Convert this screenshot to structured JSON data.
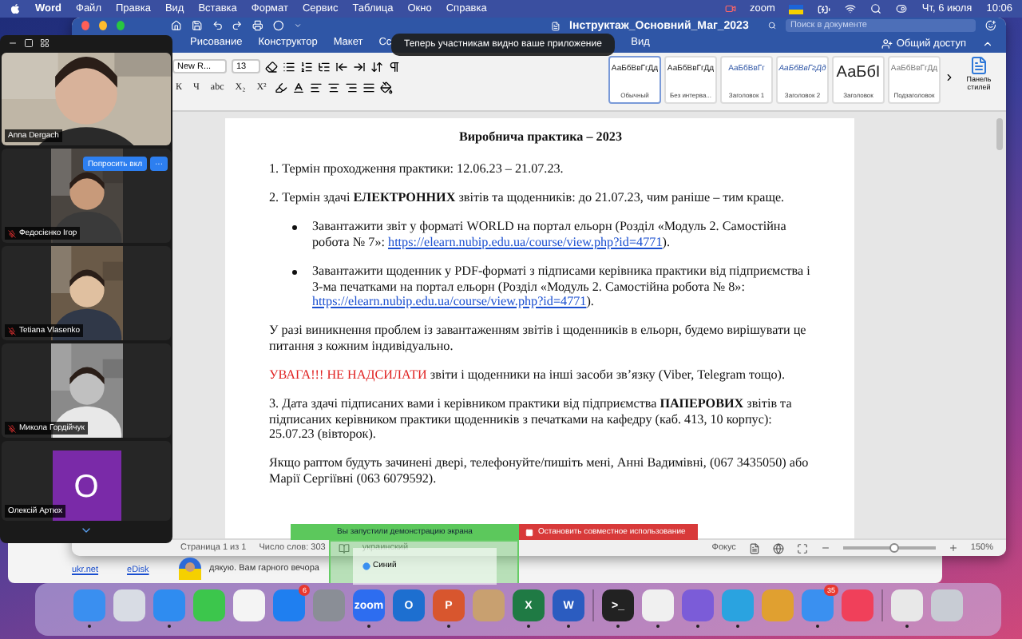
{
  "menu_bar": {
    "app": "Word",
    "items": [
      "Файл",
      "Правка",
      "Вид",
      "Вставка",
      "Формат",
      "Сервис",
      "Таблица",
      "Окно",
      "Справка"
    ],
    "zoom_label": "zoom",
    "date": "Чт, 6 июля",
    "time": "10:06"
  },
  "word": {
    "title": "Інструктаж_Основний_Маг_2023",
    "search": {
      "placeholder": "Поиск в документе"
    },
    "tabs": [
      {
        "label": "Рисование",
        "selected": false
      },
      {
        "label": "Конструктор",
        "selected": false
      },
      {
        "label": "Макет",
        "selected": false
      },
      {
        "label": "Сс",
        "selected": false
      },
      {
        "label": "Вид",
        "selected": false
      }
    ],
    "share": "Общий доступ",
    "font": {
      "name": "New R...",
      "size": "13"
    },
    "format_buttons": [
      "К",
      "Ч",
      "abc",
      "X₂",
      "X²"
    ],
    "styles": [
      {
        "preview": "АаБбВвГгДд",
        "label": "Обычный",
        "kind": "normal",
        "selected": true
      },
      {
        "preview": "АаБбВвГгДд",
        "label": "Без интерва...",
        "kind": "normal",
        "selected": false
      },
      {
        "preview": "АаБбВвГг",
        "label": "Заголовок 1",
        "kind": "heading",
        "selected": false
      },
      {
        "preview": "АаБбВвГгДд",
        "label": "Заголовок 2",
        "kind": "heading2",
        "selected": false
      },
      {
        "preview": "АаБбI",
        "label": "Заголовок",
        "kind": "title",
        "selected": false
      },
      {
        "preview": "АаБбВвГгДд",
        "label": "Подзаголовок",
        "kind": "subtitle",
        "selected": false
      }
    ],
    "styles_pane": "Панель стилей",
    "document": [
      {
        "kind": "title",
        "parts": [
          {
            "kind": "plain",
            "text": "Виробнича практика – 2023"
          }
        ]
      },
      {
        "kind": "text",
        "parts": [
          {
            "kind": "plain",
            "text": "1. Термін проходження практики: 12.06.23 – 21.07.23."
          }
        ]
      },
      {
        "kind": "text",
        "parts": [
          {
            "kind": "plain",
            "text": "2. Термін здачі **ЕЛЕКТРОННИХ** звітів та щоденників: до 21.07.23, чим раніше – тим краще."
          }
        ]
      },
      {
        "kind": "bullet",
        "parts": [
          {
            "kind": "plain",
            "text": "Завантажити звіт у форматі WORLD на портал ельорн (Розділ «Модуль 2. Самостійна робота № 7»: "
          },
          {
            "kind": "link",
            "text": "https://elearn.nubip.edu.ua/course/view.php?id=4771"
          },
          {
            "kind": "plain",
            "text": ")."
          }
        ]
      },
      {
        "kind": "bullet",
        "parts": [
          {
            "kind": "plain",
            "text": "Завантажити щоденник у PDF-форматі з підписами керівника практики від підприємства і 3-ма печатками на портал ельорн (Розділ «Модуль 2. Самостійна робота № 8»: "
          },
          {
            "kind": "link",
            "text": "https://elearn.nubip.edu.ua/course/view.php?id=4771"
          },
          {
            "kind": "plain",
            "text": ")."
          }
        ]
      },
      {
        "kind": "text",
        "parts": [
          {
            "kind": "plain",
            "text": "У разі виникнення проблем із завантаженням звітів і щоденників в ельорн, будемо вирішувати це питання з кожним індивідуально."
          }
        ]
      },
      {
        "kind": "text",
        "parts": [
          {
            "kind": "alert",
            "text": "УВАГА!!! НЕ НАДСИЛАТИ"
          },
          {
            "kind": "plain",
            "text": " звіти і щоденники на інші засоби зв’язку (Viber, Telegram тощо)."
          }
        ]
      },
      {
        "kind": "text",
        "parts": [
          {
            "kind": "plain",
            "text": "3. Дата здачі підписаних вами і керівником практики від підприємства **ПАПЕРОВИХ** звітів та підписаних керівником практики щоденників з печатками на кафедру (каб. 413, 10 корпус): 25.07.23 (вівторок)."
          }
        ]
      },
      {
        "kind": "text",
        "parts": [
          {
            "kind": "plain",
            "text": "Якщо раптом будуть зачинені двері, телефонуйте/пишіть мені, Анні Вадимівні, (067 3435050) або Марії Сергіївні (063 6079592)."
          }
        ]
      }
    ],
    "status": {
      "page": "Страница 1 из 1",
      "words": "Число слов: 303",
      "language": "украинский",
      "focus": "Фокус",
      "zoom_slider": {
        "level": 0.55
      },
      "zoom": "150%"
    }
  },
  "tooltip": "Теперь участникам видно ваше приложение",
  "participants": [
    {
      "name": "Anna Dergach",
      "kind": "speaker",
      "muted": false
    },
    {
      "name": "Федосієнко Ігор",
      "kind": "video",
      "muted": true,
      "buttons": [
        "Попросить вкл",
        "···"
      ]
    },
    {
      "name": "Tetiana Vlasenko",
      "kind": "video",
      "muted": true
    },
    {
      "name": "Микола Гордійчук",
      "kind": "video",
      "muted": true
    },
    {
      "name": "Олексій Артюх",
      "kind": "avatar",
      "muted": false,
      "initial": "О"
    }
  ],
  "share_banner": {
    "status": "Вы запустили демонстрацию экрана",
    "stop": "Остановить совместное использование",
    "preview_text": "Синий"
  },
  "back_window": {
    "links": [
      "ukr.net",
      "eDisk"
    ],
    "message": "дякую. Вам гарного вечора"
  },
  "dock": [
    {
      "kind": "app",
      "color": "#3a8ff0",
      "running": true
    },
    {
      "kind": "app",
      "color": "#d8dce4",
      "running": false
    },
    {
      "kind": "app",
      "color": "#2f8cf0",
      "running": true
    },
    {
      "kind": "app",
      "color": "#3cc64c",
      "running": false
    },
    {
      "kind": "app",
      "color": "#f4f4f4",
      "running": false
    },
    {
      "kind": "app",
      "color": "#1f7ff0",
      "running": false,
      "badge": "6"
    },
    {
      "kind": "app",
      "color": "#8a8e96",
      "running": false
    },
    {
      "kind": "app",
      "color": "#2d6df0",
      "running": true,
      "glyph": "zoom"
    },
    {
      "kind": "app",
      "color": "#1d6fd0",
      "running": false,
      "glyph": "O"
    },
    {
      "kind": "app",
      "color": "#d8562e",
      "running": true,
      "glyph": "P"
    },
    {
      "kind": "app",
      "color": "#c8a070",
      "running": false
    },
    {
      "kind": "app",
      "color": "#1f7a44",
      "running": true,
      "glyph": "X"
    },
    {
      "kind": "app",
      "color": "#2b5cc0",
      "running": true,
      "glyph": "W"
    },
    {
      "kind": "separator"
    },
    {
      "kind": "app",
      "color": "#222222",
      "running": true,
      "glyph": ">_"
    },
    {
      "kind": "app",
      "color": "#f0f0f0",
      "running": true
    },
    {
      "kind": "app",
      "color": "#7b5cd8",
      "running": true
    },
    {
      "kind": "app",
      "color": "#2aa3e0",
      "running": true
    },
    {
      "kind": "app",
      "color": "#e0a030",
      "running": false
    },
    {
      "kind": "app",
      "color": "#3a90f0",
      "running": true,
      "badge": "35"
    },
    {
      "kind": "app",
      "color": "#f0405a",
      "running": false
    },
    {
      "kind": "separator"
    },
    {
      "kind": "app",
      "color": "#e8e8e8",
      "running": true
    },
    {
      "kind": "app",
      "color": "#c8ccd4",
      "running": false
    }
  ]
}
